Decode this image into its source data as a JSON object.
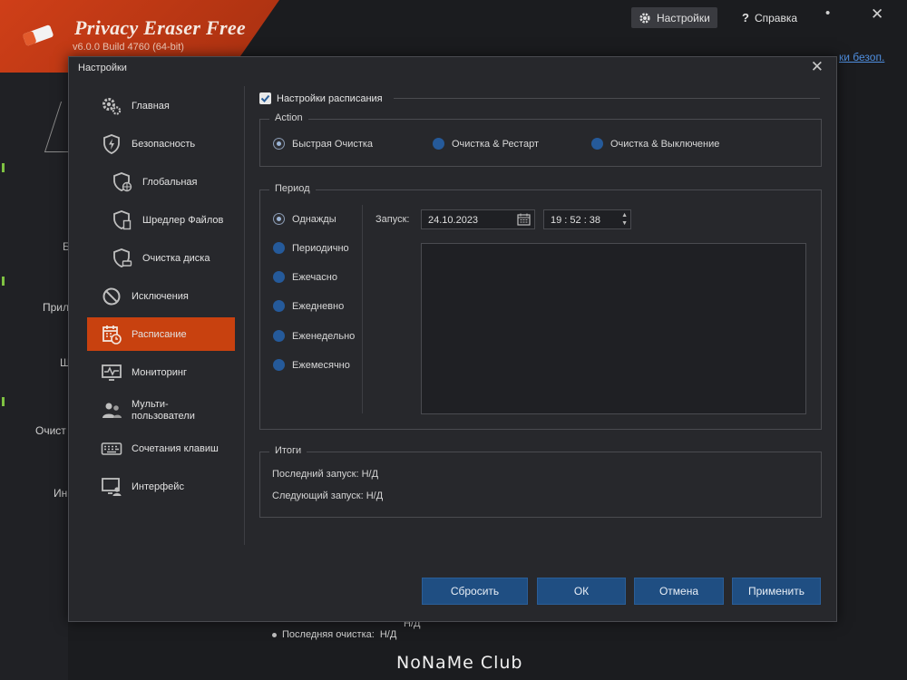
{
  "app": {
    "title": "Privacy Eraser Free",
    "version": "v6.0.0 Build 4760 (64-bit)",
    "topbar": {
      "settings_label": "Настройки",
      "help_label": "Справка"
    },
    "link_fragment": "ки безоп.",
    "bg_fragments": [
      "Б",
      "Прил",
      "Ш",
      "Очист",
      "Ин"
    ],
    "bg_bottom_label": "Последняя очистка:",
    "bg_bottom_value": "Н/Д",
    "bg_bottom_partial": "Н/Д"
  },
  "watermark": "NoNaMe Club",
  "dialog": {
    "title": "Настройки",
    "nav": [
      {
        "label": "Главная",
        "icon": "gears-icon",
        "sub": false,
        "active": false
      },
      {
        "label": "Безопасность",
        "icon": "shield-bolt-icon",
        "sub": false,
        "active": false
      },
      {
        "label": "Глобальная",
        "icon": "shield-globe-icon",
        "sub": true,
        "active": false
      },
      {
        "label": "Шредлер Файлов",
        "icon": "shield-file-icon",
        "sub": true,
        "active": false
      },
      {
        "label": "Очистка диска",
        "icon": "shield-disk-icon",
        "sub": true,
        "active": false
      },
      {
        "label": "Исключения",
        "icon": "no-entry-icon",
        "sub": false,
        "active": false
      },
      {
        "label": "Расписание",
        "icon": "calendar-clock-icon",
        "sub": false,
        "active": true
      },
      {
        "label": "Мониторинг",
        "icon": "monitor-pulse-icon",
        "sub": false,
        "active": false
      },
      {
        "label": "Мульти-\nпользователи",
        "icon": "users-icon",
        "sub": false,
        "active": false
      },
      {
        "label": "Сочетания клавиш",
        "icon": "keyboard-icon",
        "sub": false,
        "active": false
      },
      {
        "label": "Интерфейс",
        "icon": "monitor-user-icon",
        "sub": false,
        "active": false
      }
    ],
    "schedule_checkbox": "Настройки расписания",
    "action": {
      "title": "Action",
      "options": [
        "Быстрая Очистка",
        "Очистка & Рестарт",
        "Очистка & Выключение"
      ],
      "selected": 0
    },
    "period": {
      "title": "Период",
      "options": [
        "Однажды",
        "Периодично",
        "Ежечасно",
        "Ежедневно",
        "Еженедельно",
        "Ежемесячно"
      ],
      "selected": 0,
      "start_label": "Запуск:",
      "date": "24.10.2023",
      "time": "19 : 52 : 38"
    },
    "summary": {
      "title": "Итоги",
      "last_run": "Последний запуск: Н/Д",
      "next_run": "Следующий запуск: Н/Д"
    },
    "buttons": {
      "reset": "Сбросить",
      "ok": "ОК",
      "cancel": "Отмена",
      "apply": "Применить"
    }
  },
  "colors": {
    "accent": "#c8410f",
    "button": "#1f4e82",
    "radio": "#255a9a"
  }
}
